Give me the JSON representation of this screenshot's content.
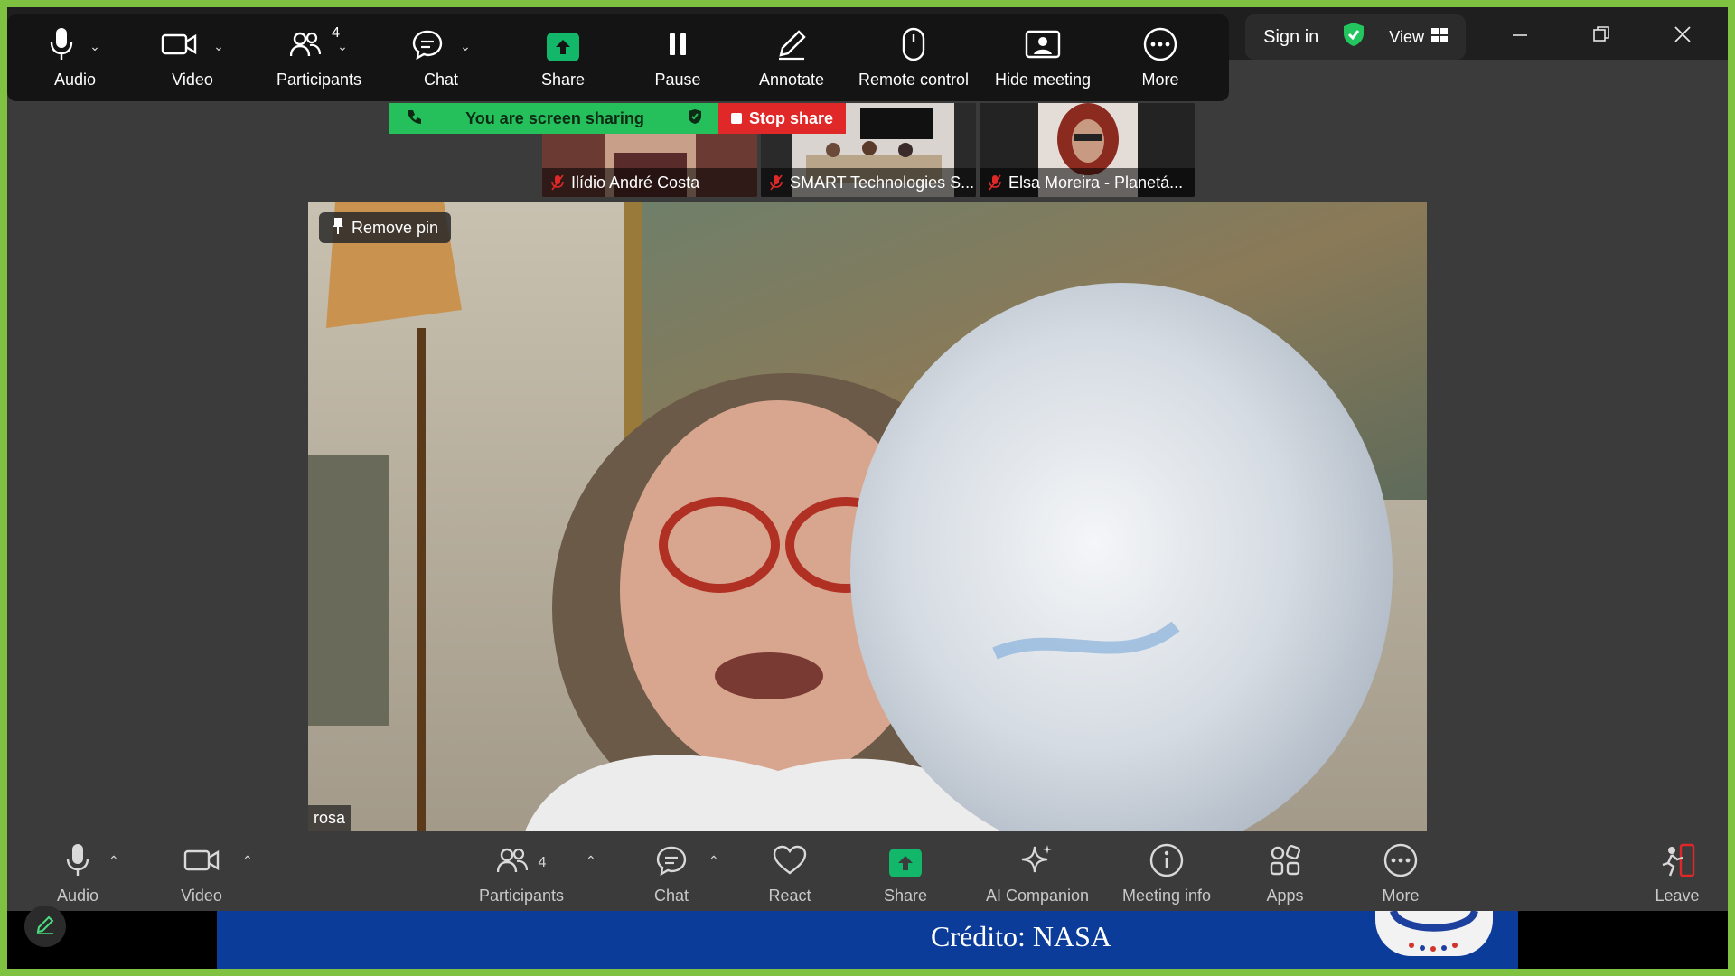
{
  "window": {
    "sign_in": "Sign in",
    "view": "View"
  },
  "share_toolbar": {
    "items": [
      {
        "label": "Audio",
        "icon": "microphone-icon"
      },
      {
        "label": "Video",
        "icon": "video-camera-icon"
      },
      {
        "label": "Participants",
        "icon": "participants-icon",
        "count": "4"
      },
      {
        "label": "Chat",
        "icon": "chat-icon"
      },
      {
        "label": "Share",
        "icon": "share-screen-icon"
      },
      {
        "label": "Pause",
        "icon": "pause-icon"
      },
      {
        "label": "Annotate",
        "icon": "pencil-icon"
      },
      {
        "label": "Remote control",
        "icon": "mouse-icon"
      },
      {
        "label": "Hide meeting",
        "icon": "hide-meeting-icon"
      },
      {
        "label": "More",
        "icon": "more-icon"
      }
    ]
  },
  "banner": {
    "sharing_text": "You are screen sharing",
    "stop_share": "Stop share"
  },
  "thumbnails": [
    {
      "name": "Ilídio André Costa",
      "muted": true
    },
    {
      "name": "SMART Technologies S...",
      "muted": true
    },
    {
      "name": "Elsa Moreira - Planetá...",
      "muted": true
    }
  ],
  "main_video": {
    "pin_label": "Remove pin",
    "participant_name": "rosa"
  },
  "bottom_bar": {
    "items": [
      {
        "label": "Audio",
        "icon": "microphone-icon"
      },
      {
        "label": "Video",
        "icon": "video-camera-icon"
      },
      {
        "label": "Participants",
        "icon": "participants-icon",
        "count": "4"
      },
      {
        "label": "Chat",
        "icon": "chat-icon"
      },
      {
        "label": "React",
        "icon": "heart-icon"
      },
      {
        "label": "Share",
        "icon": "share-screen-icon"
      },
      {
        "label": "AI Companion",
        "icon": "sparkle-icon"
      },
      {
        "label": "Meeting info",
        "icon": "info-icon"
      },
      {
        "label": "Apps",
        "icon": "apps-icon"
      },
      {
        "label": "More",
        "icon": "more-icon"
      },
      {
        "label": "Leave",
        "icon": "leave-icon"
      }
    ]
  },
  "slide": {
    "credit": "Crédito: NASA"
  },
  "colors": {
    "share_border": "#7fc242",
    "share_green": "#12b76a",
    "stop_red": "#e02828",
    "banner_green": "#25c05b",
    "slide_blue": "#0b3c99"
  }
}
